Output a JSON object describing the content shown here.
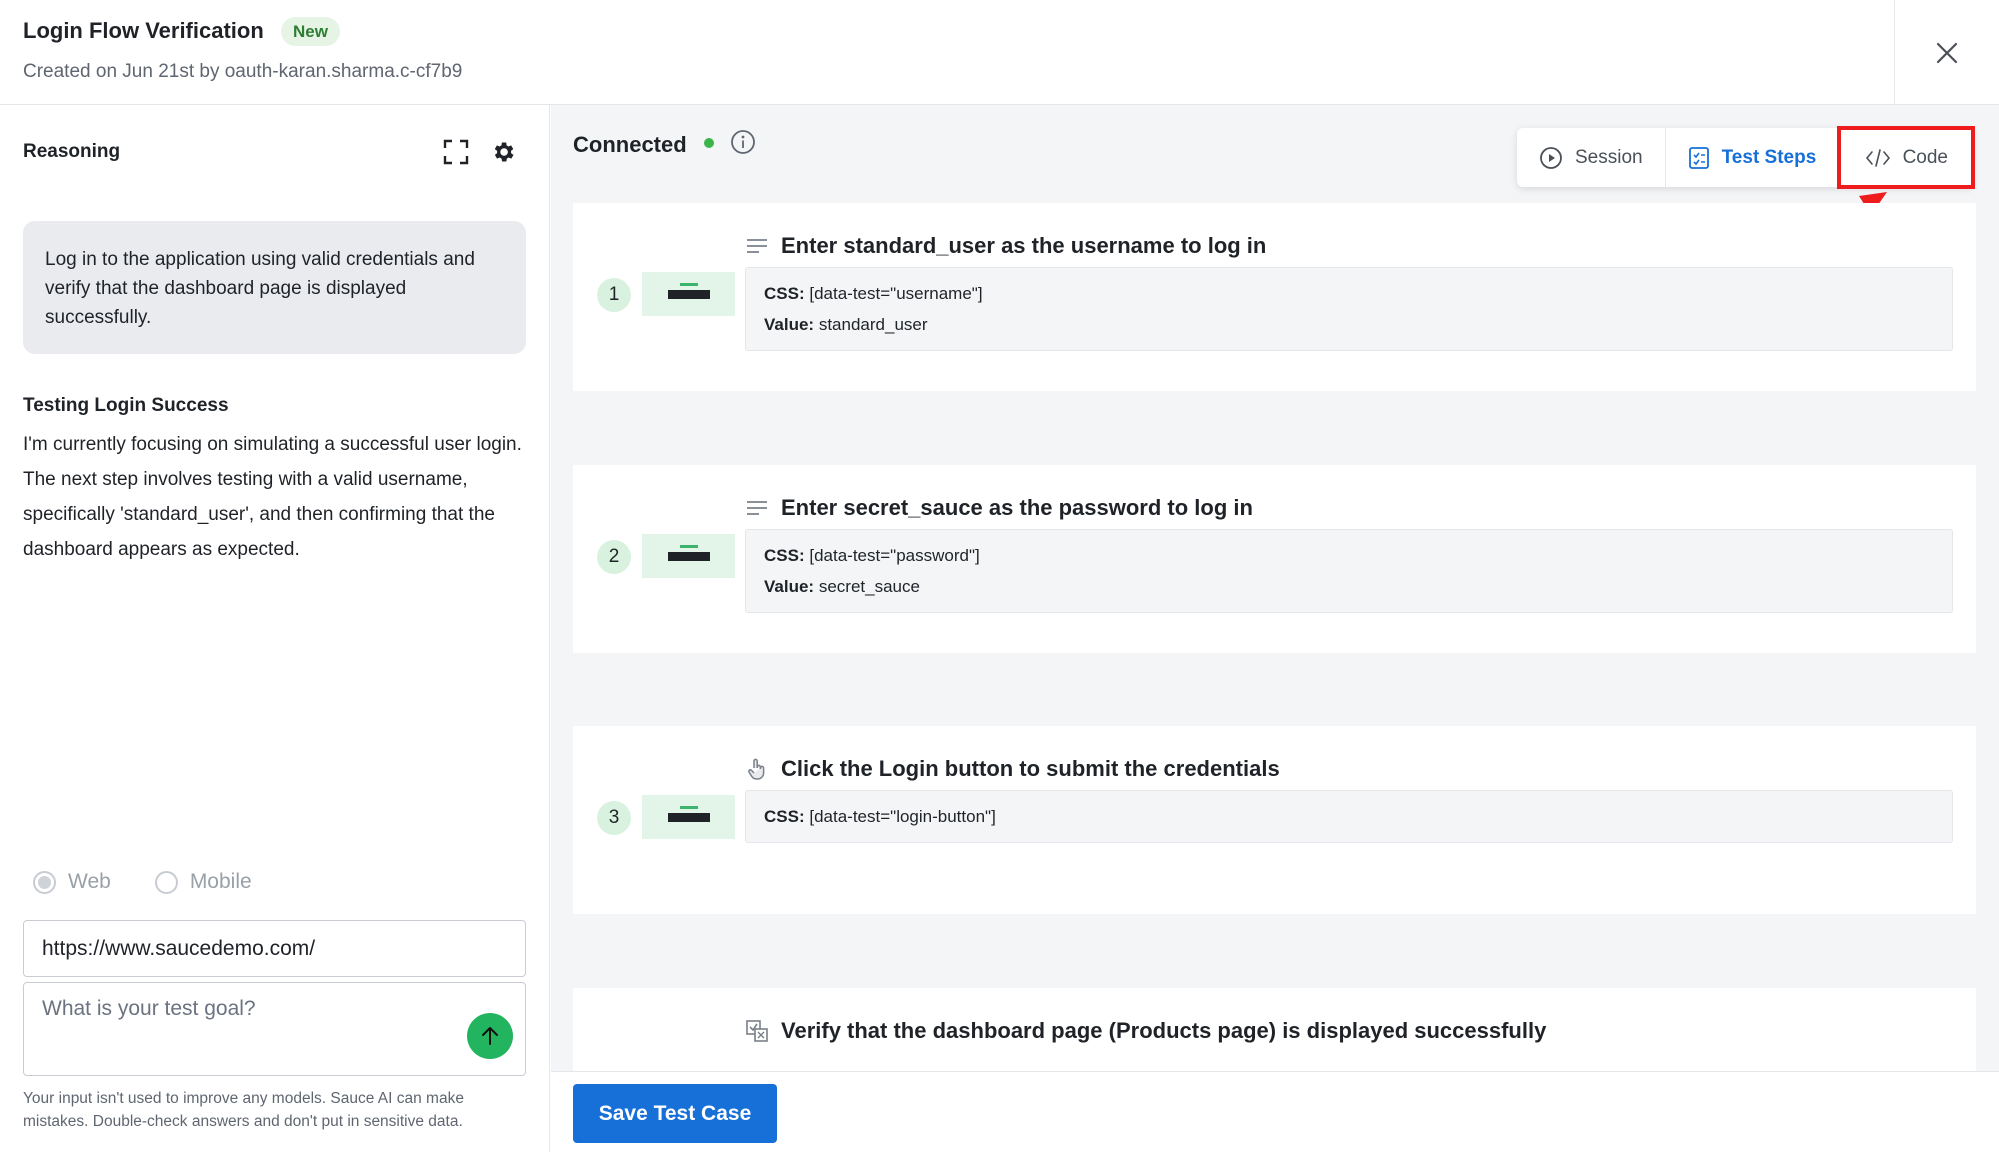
{
  "header": {
    "title": "Login Flow Verification",
    "badge": "New",
    "subtitle": "Created on Jun 21st by oauth-karan.sharma.c-cf7b9"
  },
  "left": {
    "reasoning_label": "Reasoning",
    "goal_text": "Log in to the application using valid credentials and verify that the dashboard page is displayed successfully.",
    "thinking_title": "Testing Login Success",
    "thinking_body": "I'm currently focusing on simulating a successful user login. The next step involves testing with a valid username, specifically 'standard_user', and then confirming that the dashboard appears as expected.",
    "platform": {
      "web_label": "Web",
      "mobile_label": "Mobile",
      "selected": "Web"
    },
    "url_value": "https://www.saucedemo.com/",
    "goal_placeholder": "What is your test goal?",
    "disclaimer": "Your input isn't used to improve any models. Sauce AI can make mistakes. Double-check answers and don't put in sensitive data."
  },
  "right": {
    "status_label": "Connected",
    "status_color": "#3cb44b",
    "tabs": [
      {
        "label": "Session",
        "icon": "play-circle-icon"
      },
      {
        "label": "Test Steps",
        "icon": "checklist-icon",
        "active": true
      },
      {
        "label": "Code",
        "icon": "code-icon",
        "highlighted": true
      }
    ],
    "steps": [
      {
        "number": "1",
        "icon": "type-text-icon",
        "title": "Enter standard_user as the username to log in",
        "css_label": "CSS:",
        "css_value": "[data-test=\"username\"]",
        "value_label": "Value:",
        "value": "standard_user"
      },
      {
        "number": "2",
        "icon": "type-text-icon",
        "title": "Enter secret_sauce as the password to log in",
        "css_label": "CSS:",
        "css_value": "[data-test=\"password\"]",
        "value_label": "Value:",
        "value": "secret_sauce"
      },
      {
        "number": "3",
        "icon": "tap-icon",
        "title": "Click the Login button to submit the credentials",
        "css_label": "CSS:",
        "css_value": "[data-test=\"login-button\"]"
      },
      {
        "icon": "verify-icon",
        "title": "Verify that the dashboard page (Products page) is displayed successfully"
      }
    ]
  },
  "footer": {
    "save_label": "Save Test Case"
  },
  "colors": {
    "accent": "#1670d8",
    "highlight": "#ee1c1c",
    "send_button": "#22b45e"
  }
}
